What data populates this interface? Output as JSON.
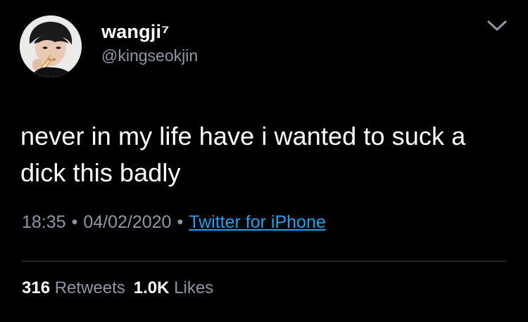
{
  "user": {
    "display_name": "wangji⁷",
    "handle": "@kingseokjin"
  },
  "tweet": {
    "text": "never in my life have i wanted to suck a dick this badly",
    "time": "18:35",
    "date": "04/02/2020",
    "separator": "•",
    "source": "Twitter for iPhone"
  },
  "stats": {
    "retweets_count": "316",
    "retweets_label": "Retweets",
    "likes_count": "1.0K",
    "likes_label": "Likes"
  },
  "icons": {
    "menu": "chevron-down-icon"
  },
  "colors": {
    "background": "#000000",
    "text": "#ffffff",
    "secondary": "#8b98a5",
    "link": "#1da1f2",
    "divider": "#3d4349"
  }
}
